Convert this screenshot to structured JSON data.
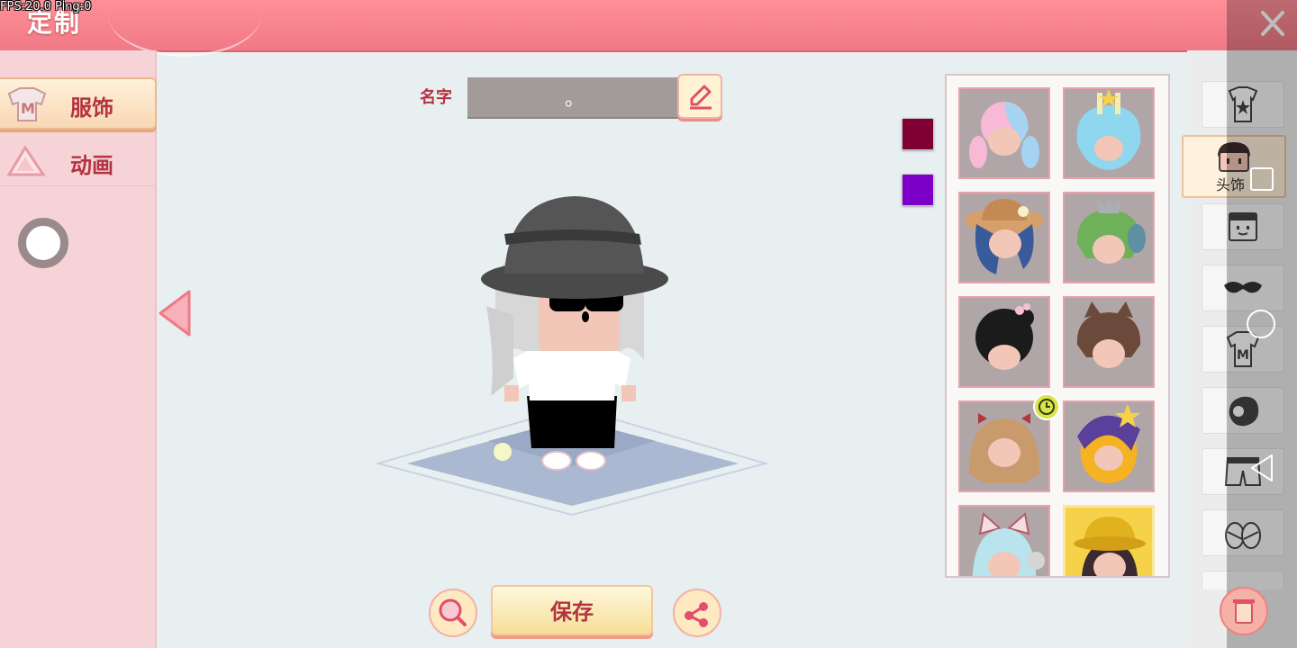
{
  "status": {
    "fps_text": "FPS:20.0  Ping:0"
  },
  "header": {
    "title": "定制",
    "close_icon": "close-icon"
  },
  "left_tabs": [
    {
      "label": "服饰",
      "icon": "shirt-m-icon",
      "selected": true
    },
    {
      "label": "动画",
      "icon": "animation-triangle-icon",
      "selected": false
    }
  ],
  "name_bar": {
    "label": "名字",
    "value": "。",
    "edit_icon": "pencil-icon"
  },
  "colors": {
    "swatch_1": "#7f0032",
    "swatch_2": "#7c00c8",
    "accent": "#b43340",
    "header": "#f07986"
  },
  "items": [
    {
      "name": "pink-blue-pigtails-hair",
      "selected": false
    },
    {
      "name": "blue-frosting-crown-hair",
      "selected": false
    },
    {
      "name": "straw-hat-flower-braid-hair",
      "selected": false
    },
    {
      "name": "green-fish-crown-hair",
      "selected": false
    },
    {
      "name": "black-bun-blossom-hair",
      "selected": false
    },
    {
      "name": "brown-cat-ears-hair",
      "selected": false
    },
    {
      "name": "blonde-bow-wavy-hair",
      "selected": false,
      "timed": true
    },
    {
      "name": "witch-hat-blonde-hair",
      "selected": false
    },
    {
      "name": "cat-ear-headphones-hair",
      "selected": false
    },
    {
      "name": "yellow-bucket-hat-hair",
      "selected": true
    }
  ],
  "footer": {
    "save_label": "保存",
    "zoom_icon": "magnifier-icon",
    "share_icon": "share-icon"
  },
  "categories": [
    {
      "icon": "top-shirt-icon"
    },
    {
      "icon": "head-icon",
      "label": "头饰",
      "selected": true
    },
    {
      "icon": "face-icon"
    },
    {
      "icon": "eye-mask-icon"
    },
    {
      "icon": "shirt-m-icon"
    },
    {
      "icon": "glove-icon"
    },
    {
      "icon": "shorts-icon"
    },
    {
      "icon": "shoes-icon"
    }
  ],
  "system_nav": {
    "square_icon": "recent-apps-icon",
    "circle_icon": "home-icon",
    "back_icon": "back-icon"
  }
}
